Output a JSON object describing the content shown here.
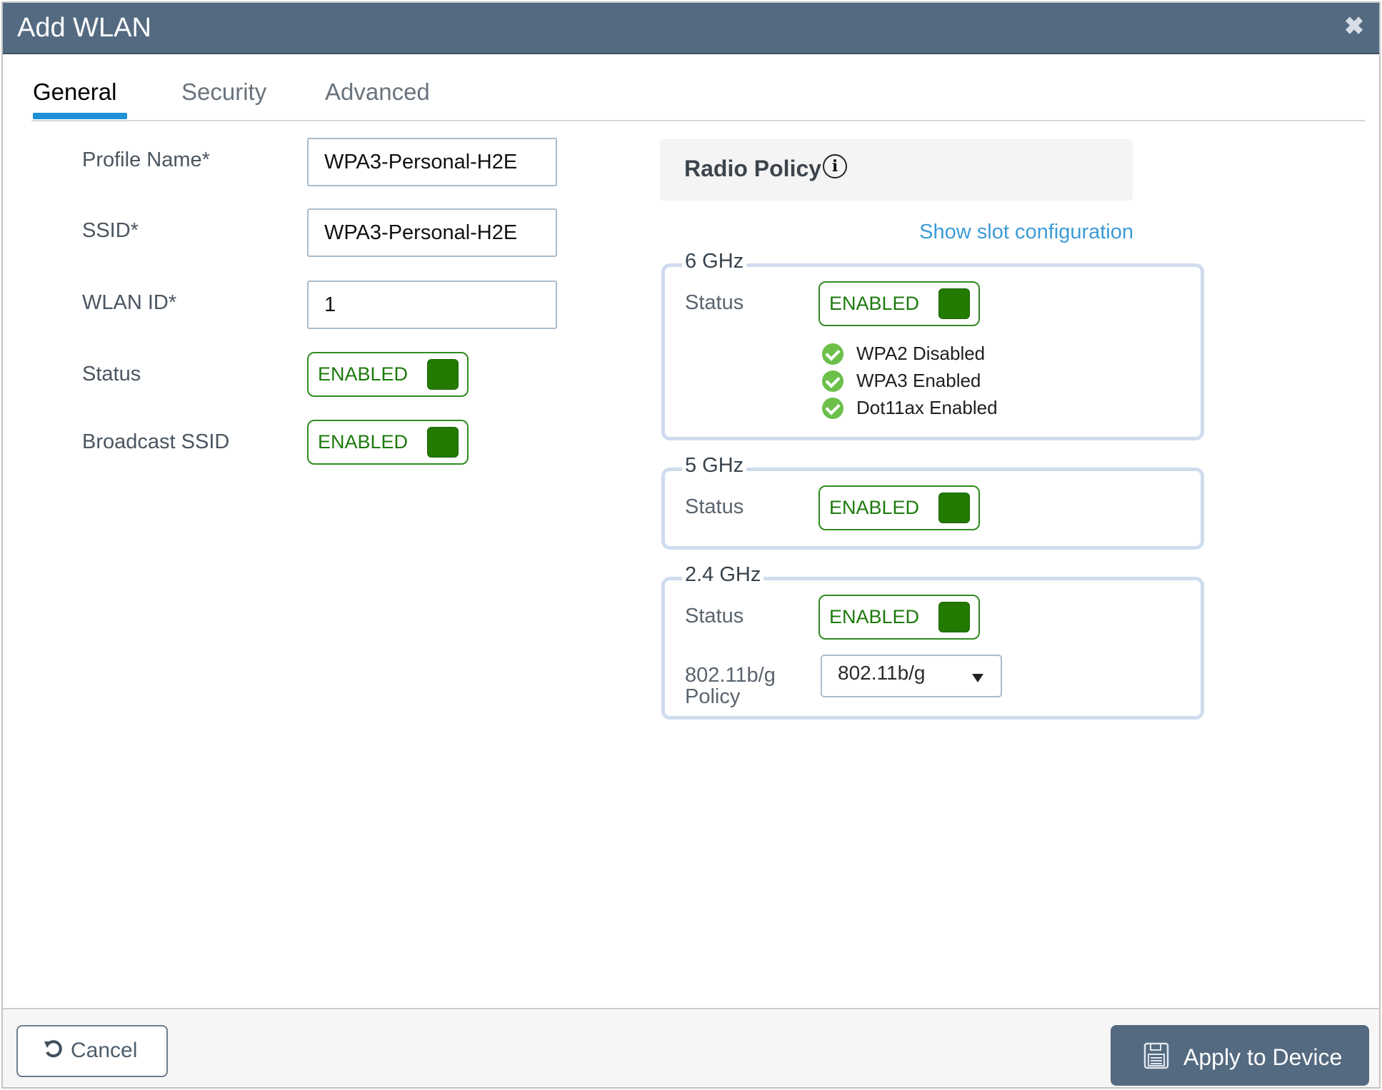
{
  "dialog": {
    "title": "Add WLAN",
    "close_icon": "close-x-icon"
  },
  "tabs": [
    {
      "label": "General",
      "active": true
    },
    {
      "label": "Security",
      "active": false
    },
    {
      "label": "Advanced",
      "active": false
    }
  ],
  "general": {
    "profile_name": {
      "label": "Profile Name*",
      "value": "WPA3-Personal-H2E"
    },
    "ssid": {
      "label": "SSID*",
      "value": "WPA3-Personal-H2E"
    },
    "wlan_id": {
      "label": "WLAN ID*",
      "value": "1"
    },
    "status": {
      "label": "Status",
      "toggle": "ENABLED"
    },
    "broadcast_ssid": {
      "label": "Broadcast SSID",
      "toggle": "ENABLED"
    }
  },
  "radio_policy": {
    "title": "Radio Policy",
    "info_icon": "info-icon",
    "show_slot_link": "Show slot configuration",
    "bands": {
      "ghz6": {
        "legend": "6 GHz",
        "status_label": "Status",
        "status": "ENABLED",
        "checks": [
          "WPA2 Disabled",
          "WPA3 Enabled",
          "Dot11ax Enabled"
        ]
      },
      "ghz5": {
        "legend": "5 GHz",
        "status_label": "Status",
        "status": "ENABLED"
      },
      "ghz24": {
        "legend": "2.4 GHz",
        "status_label": "Status",
        "status": "ENABLED",
        "policy_label_line1": "802.11b/g",
        "policy_label_line2": "Policy",
        "policy_value": "802.11b/g"
      }
    }
  },
  "footer": {
    "cancel_label": "Cancel",
    "apply_label": "Apply to Device"
  },
  "colors": {
    "titlebar": "#546a80",
    "tab_active_underline": "#1e90d6",
    "toggle_green": "#227a00",
    "link_blue": "#3c9bd6",
    "check_green": "#6cc04a"
  }
}
